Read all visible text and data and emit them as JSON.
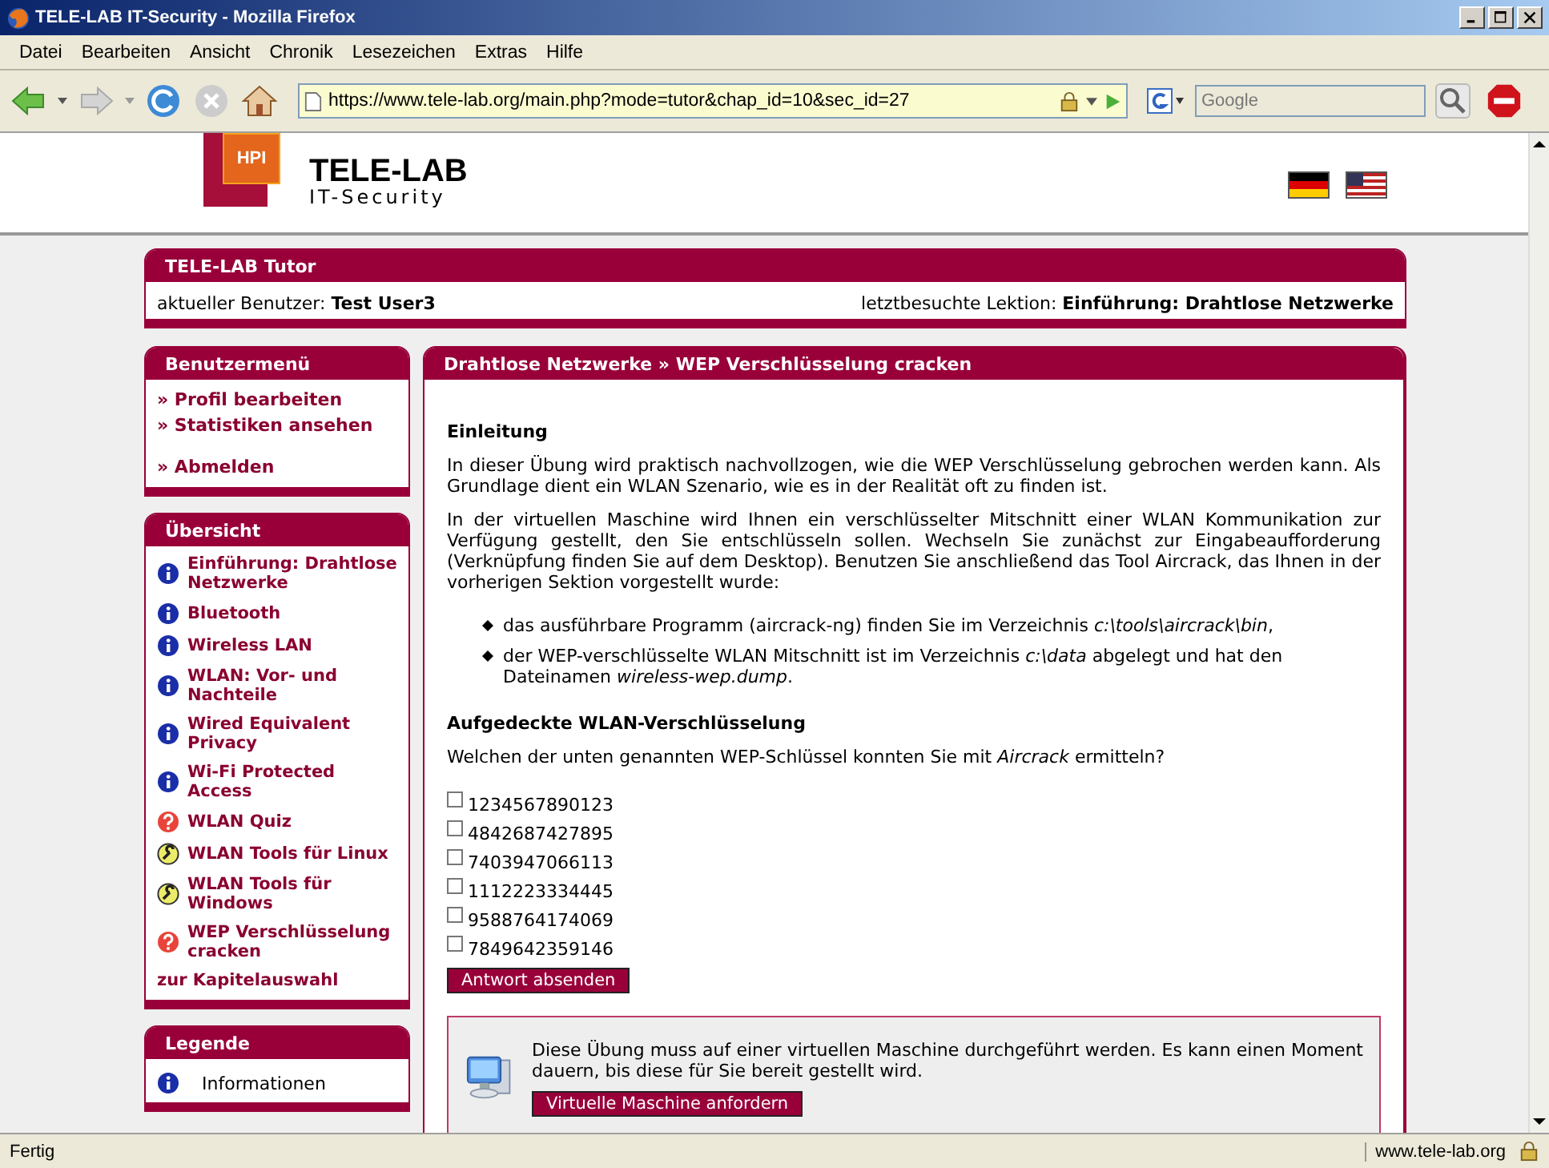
{
  "window": {
    "title": "TELE-LAB IT-Security - Mozilla Firefox"
  },
  "menu": [
    "Datei",
    "Bearbeiten",
    "Ansicht",
    "Chronik",
    "Lesezeichen",
    "Extras",
    "Hilfe"
  ],
  "toolbar": {
    "url": "https://www.tele-lab.org/main.php?mode=tutor&chap_id=10&sec_id=27",
    "search_placeholder": "Google"
  },
  "header": {
    "logo_mark": "HPI",
    "logo_title": "TELE-LAB",
    "logo_subtitle": "IT-Security"
  },
  "tutor": {
    "title": "TELE-LAB Tutor",
    "user_label": "aktueller Benutzer:",
    "user": "Test User3",
    "lesson_label": "letztbesuchte Lektion:",
    "lesson": "Einführung: Drahtlose Netzwerke"
  },
  "user_menu": {
    "title": "Benutzermenü",
    "items": [
      {
        "label": "» Profil bearbeiten"
      },
      {
        "label": "» Statistiken ansehen"
      },
      {
        "label": "» Abmelden"
      }
    ]
  },
  "overview": {
    "title": "Übersicht",
    "items": [
      {
        "kind": "info",
        "label": "Einführung: Drahtlose Netzwerke"
      },
      {
        "kind": "info",
        "label": "Bluetooth"
      },
      {
        "kind": "info",
        "label": "Wireless LAN"
      },
      {
        "kind": "info",
        "label": "WLAN: Vor- und Nachteile"
      },
      {
        "kind": "info",
        "label": "Wired Equivalent Privacy"
      },
      {
        "kind": "info",
        "label": "Wi-Fi Protected Access"
      },
      {
        "kind": "quiz",
        "label": "WLAN Quiz"
      },
      {
        "kind": "tool",
        "label": "WLAN Tools für Linux"
      },
      {
        "kind": "tool",
        "label": "WLAN Tools für Windows"
      },
      {
        "kind": "quiz",
        "label": "WEP Verschlüsselung cracken"
      }
    ],
    "footer_link": "zur Kapitelauswahl"
  },
  "legend": {
    "title": "Legende",
    "items": [
      {
        "kind": "info",
        "label": "Informationen"
      }
    ]
  },
  "main": {
    "breadcrumb": "Drahtlose Netzwerke » WEP Verschlüsselung cracken",
    "intro_heading": "Einleitung",
    "paragraphs": [
      "In dieser Übung wird praktisch nachvollzogen, wie die WEP Verschlüsselung gebrochen werden kann. Als Grundlage dient ein WLAN Szenario, wie es in der Realität oft zu finden ist.",
      "In der virtuellen Maschine wird Ihnen ein verschlüsselter Mitschnitt einer WLAN Kommunikation zur Verfügung gestellt, den Sie entschlüsseln sollen. Wechseln Sie zunächst zur Eingabeaufforderung (Verknüpfung finden Sie auf dem Desktop). Benutzen Sie anschließend das Tool Aircrack, das Ihnen in der vorherigen Sektion vorgestellt wurde:"
    ],
    "bullets": [
      "das ausführbare Programm (aircrack-ng) finden Sie im Verzeichnis *c:\\tools\\aircrack\\bin*,",
      "der WEP-verschlüsselte WLAN Mitschnitt ist im Verzeichnis *c:\\data* abgelegt und hat den Dateinamen *wireless-wep.dump*."
    ],
    "quiz_heading": "Aufgedeckte WLAN-Verschlüsselung",
    "question": "Welchen der unten genannten WEP-Schlüssel konnten Sie mit *Aircrack* ermitteln?",
    "options": [
      {
        "label": "1234567890123",
        "checked": false
      },
      {
        "label": "4842687427895",
        "checked": false
      },
      {
        "label": "7403947066113",
        "checked": false
      },
      {
        "label": "1112223334445",
        "checked": false
      },
      {
        "label": "9588764174069",
        "checked": false
      },
      {
        "label": "7849642359146",
        "checked": false
      }
    ],
    "submit_button": "Antwort absenden",
    "vm_notice": {
      "text": "Diese Übung muss auf einer virtuellen Maschine durchgeführt werden. Es kann einen Moment dauern, bis diese für Sie bereit gestellt wird.",
      "button": "Virtuelle Maschine anfordern"
    }
  },
  "status_bar": {
    "text": "Fertig",
    "url": "www.tele-lab.org"
  }
}
